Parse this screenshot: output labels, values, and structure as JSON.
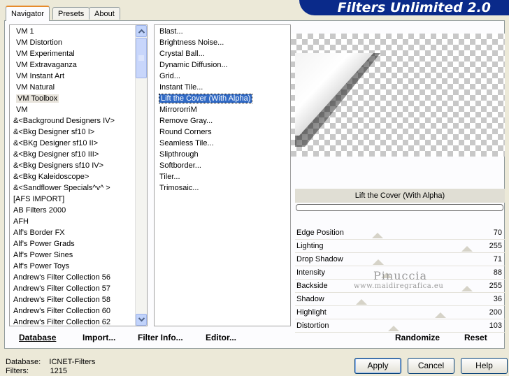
{
  "title": "Filters Unlimited 2.0",
  "tabs": [
    "Navigator",
    "Presets",
    "About"
  ],
  "categories": [
    "VM 1",
    "VM Distortion",
    "VM Experimental",
    "VM Extravaganza",
    "VM Instant Art",
    "VM Natural",
    "VM Toolbox",
    "VM",
    "&<Background Designers IV>",
    "&<Bkg Designer sf10 I>",
    "&<BKg Designer sf10 II>",
    "&<Bkg Designer sf10 III>",
    "&<Bkg Designers sf10 IV>",
    "&<Bkg Kaleidoscope>",
    "&<Sandflower Specials^v^ >",
    "[AFS IMPORT]",
    "AB Filters 2000",
    "AFH",
    "Alf's Border FX",
    "Alf's Power Grads",
    "Alf's Power Sines",
    "Alf's Power Toys",
    "Andrew's Filter Collection 56",
    "Andrew's Filter Collection 57",
    "Andrew's Filter Collection 58",
    "Andrew's Filter Collection 60",
    "Andrew's Filter Collection 62"
  ],
  "selected_category": "VM Toolbox",
  "filters": [
    "Blast...",
    "Brightness Noise...",
    "Crystal Ball...",
    "Dynamic Diffusion...",
    "Grid...",
    "Instant Tile...",
    "Lift the Cover (With Alpha)",
    "MirrororriM",
    "Remove Gray...",
    "Round Corners",
    "Seamless Tile...",
    "Slipthrough",
    "Softborder...",
    "Tiler...",
    "Trimosaic..."
  ],
  "selected_filter": "Lift the Cover (With Alpha)",
  "current_filter_label": "Lift the Cover (With Alpha)",
  "params": [
    {
      "name": "Edge Position",
      "value": "70",
      "level": 0.275
    },
    {
      "name": "Lighting",
      "value": "255",
      "level": 1.0
    },
    {
      "name": "Drop Shadow",
      "value": "71",
      "level": 0.278
    },
    {
      "name": "Intensity",
      "value": "88",
      "level": 0.345
    },
    {
      "name": "Backside",
      "value": "255",
      "level": 1.0
    },
    {
      "name": "Shadow",
      "value": "36",
      "level": 0.141
    },
    {
      "name": "Highlight",
      "value": "200",
      "level": 0.784
    },
    {
      "name": "Distortion",
      "value": "103",
      "level": 0.404
    }
  ],
  "watermark": {
    "name": "Pinuccia",
    "site": "www.maidiregrafica.eu"
  },
  "left_buttons": {
    "database": "Database",
    "import": "Import...",
    "filter_info": "Filter Info...",
    "editor": "Editor..."
  },
  "right_buttons": {
    "randomize": "Randomize",
    "reset": "Reset"
  },
  "status": {
    "database_label": "Database:",
    "database_value": "ICNET-Filters",
    "filters_label": "Filters:",
    "filters_value": "1215"
  },
  "dialog_buttons": {
    "apply": "Apply",
    "cancel": "Cancel",
    "help": "Help"
  },
  "colors": {
    "accent": "#316ac5",
    "banner": "#0a2a8a",
    "tab_highlight": "#e68b2c"
  }
}
